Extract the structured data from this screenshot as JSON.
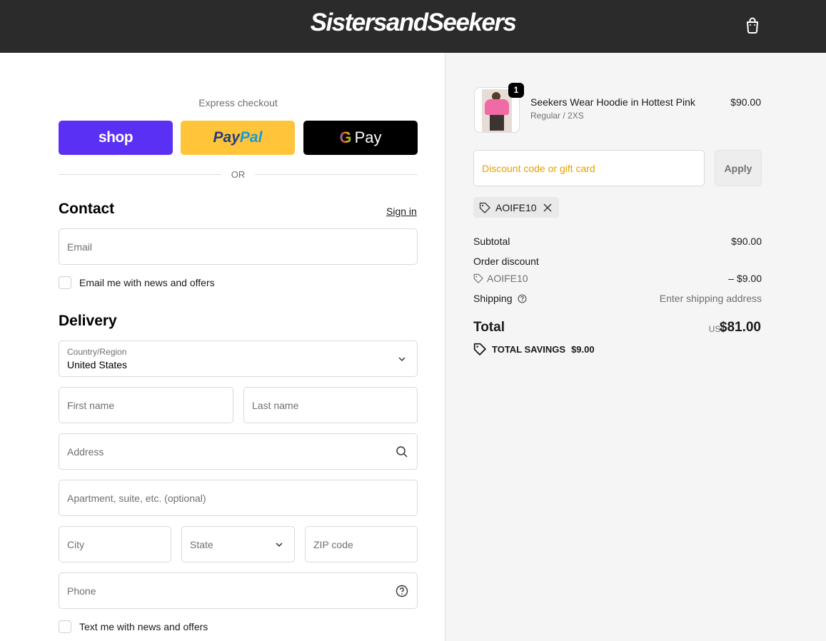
{
  "header": {
    "brand": "SistersandSeekers",
    "cart_icon": "shopping-bag-icon"
  },
  "express": {
    "label": "Express checkout",
    "shop_label": "shop",
    "paypal_label_1": "Pay",
    "paypal_label_2": "Pal",
    "gpay_g": "G",
    "gpay_label": "Pay",
    "or_label": "OR"
  },
  "contact": {
    "title": "Contact",
    "signin": "Sign in",
    "email_placeholder": "Email",
    "news_label": "Email me with news and offers"
  },
  "delivery": {
    "title": "Delivery",
    "country_label": "Country/Region",
    "country_value": "United States",
    "first_name": "First name",
    "last_name": "Last name",
    "address": "Address",
    "apartment": "Apartment, suite, etc. (optional)",
    "city": "City",
    "state": "State",
    "zip": "ZIP code",
    "phone": "Phone",
    "text_news_label": "Text me with news and offers"
  },
  "cart": {
    "item": {
      "quantity": "1",
      "name": "Seekers Wear Hoodie in Hottest Pink",
      "variant": "Regular / 2XS",
      "price": "$90.00"
    },
    "discount_placeholder": "Discount code or gift card",
    "apply_label": "Apply",
    "applied_code": "AOIFE10"
  },
  "summary": {
    "subtotal_label": "Subtotal",
    "subtotal_value": "$90.00",
    "order_discount_label": "Order discount",
    "discount_code": "AOIFE10",
    "discount_value": "– $9.00",
    "shipping_label": "Shipping",
    "shipping_value": "Enter shipping address",
    "total_label": "Total",
    "currency": "USD",
    "total_value": "$81.00",
    "savings_label": "TOTAL SAVINGS",
    "savings_value": "$9.00"
  },
  "colors": {
    "header_bg": "#2b2b2b",
    "shop_pay": "#5a31f4",
    "paypal": "#ffc439",
    "gpay": "#000000",
    "discount_placeholder": "#e6a000"
  }
}
